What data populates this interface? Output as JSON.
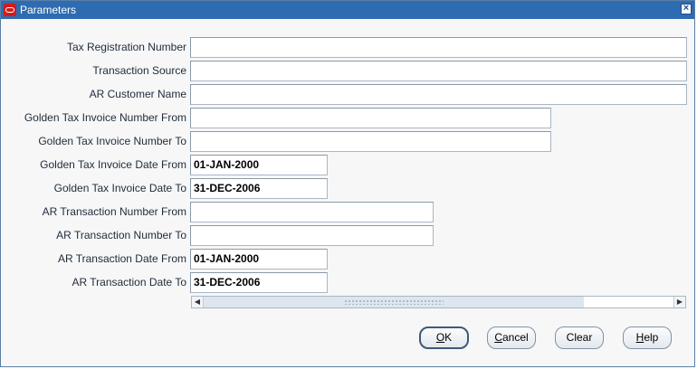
{
  "window": {
    "title": "Parameters"
  },
  "fields": [
    {
      "label": "Tax Registration Number",
      "value": ""
    },
    {
      "label": "Transaction Source",
      "value": ""
    },
    {
      "label": "AR Customer Name",
      "value": ""
    },
    {
      "label": "Golden Tax Invoice Number From",
      "value": ""
    },
    {
      "label": "Golden Tax Invoice Number To",
      "value": ""
    },
    {
      "label": "Golden Tax Invoice Date From",
      "value": "01-JAN-2000"
    },
    {
      "label": "Golden Tax Invoice Date To",
      "value": "31-DEC-2006"
    },
    {
      "label": "AR Transaction Number From",
      "value": ""
    },
    {
      "label": "AR Transaction Number To",
      "value": ""
    },
    {
      "label": "AR Transaction Date From",
      "value": "01-JAN-2000"
    },
    {
      "label": "AR Transaction Date To",
      "value": "31-DEC-2006"
    }
  ],
  "buttons": {
    "ok": {
      "mnemonic": "O",
      "rest": "K"
    },
    "cancel": {
      "mnemonic": "C",
      "rest": "ancel"
    },
    "clear": {
      "label": "Clear"
    },
    "help": {
      "mnemonic": "H",
      "rest": "elp"
    }
  },
  "icons": {
    "app": "oracle-logo-icon",
    "close": "close-icon",
    "scroll_left": "arrow-left-icon",
    "scroll_right": "arrow-right-icon"
  }
}
